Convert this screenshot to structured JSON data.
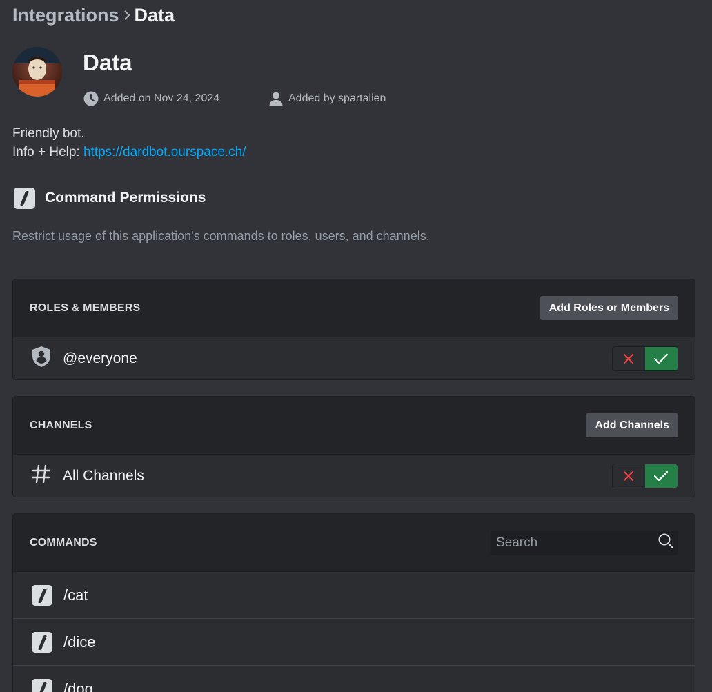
{
  "breadcrumb": {
    "parent": "Integrations",
    "current": "Data"
  },
  "app": {
    "name": "Data",
    "added_on": "Added on Nov 24, 2024",
    "added_by": "Added by spartalien",
    "description_line1": "Friendly bot.",
    "description_help_label": "Info + Help: ",
    "description_link": "https://dardbot.ourspace.ch/"
  },
  "permissions": {
    "title": "Command Permissions",
    "subtitle": "Restrict usage of this application's commands to roles, users, and channels."
  },
  "roles_card": {
    "header": "ROLES & MEMBERS",
    "add_button": "Add Roles or Members",
    "rows": [
      {
        "name": "@everyone",
        "state": "allow",
        "icon": "role-shield-icon"
      }
    ]
  },
  "channels_card": {
    "header": "CHANNELS",
    "add_button": "Add Channels",
    "rows": [
      {
        "name": "All Channels",
        "state": "allow",
        "icon": "hash-icon"
      }
    ]
  },
  "commands_card": {
    "header": "COMMANDS",
    "search_placeholder": "Search",
    "commands": [
      "/cat",
      "/dice",
      "/dog"
    ]
  },
  "colors": {
    "allow": "#248046",
    "deny_icon": "#f23f43",
    "link": "#00a8fc",
    "background": "#313338"
  }
}
